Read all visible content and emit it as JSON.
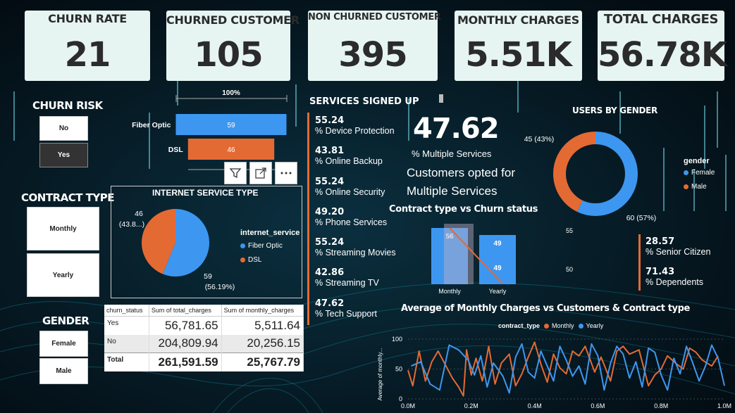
{
  "colors": {
    "orange": "#e46a33",
    "blue": "#3d97f0",
    "card": "#e6f5f2",
    "bg": "#041018"
  },
  "cards": [
    {
      "label": "CHURN RATE",
      "value": "21"
    },
    {
      "label": "CHURNED CUSTOMER",
      "value": "105"
    },
    {
      "label": "NON CHURNED CUSTOMER",
      "value": "395"
    },
    {
      "label": "MONTHLY CHARGES",
      "value": "5.51K"
    },
    {
      "label": "TOTAL CHARGES",
      "value": "56.78K"
    }
  ],
  "slicers": {
    "churn_risk": {
      "title": "CHURN RISK",
      "options": [
        "No",
        "Yes"
      ],
      "selected": "Yes"
    },
    "contract_type": {
      "title": "CONTRACT TYPE",
      "options": [
        "Monthly",
        "Yearly"
      ]
    },
    "gender": {
      "title": "GENDER",
      "options": [
        "Female",
        "Male"
      ]
    }
  },
  "visual_icons": [
    "filter-icon",
    "focus-mode-icon",
    "more-options-icon"
  ],
  "services": {
    "title": "SERVICES SIGNED UP",
    "items": [
      {
        "value": "55.24",
        "label": "% Device Protection"
      },
      {
        "value": "43.81",
        "label": "% Online Backup"
      },
      {
        "value": "55.24",
        "label": "% Online Security"
      },
      {
        "value": "49.20",
        "label": "% Phone Services"
      },
      {
        "value": "55.24",
        "label": "% Streaming Movies"
      },
      {
        "value": "42.86",
        "label": "% Streaming TV"
      },
      {
        "value": "47.62",
        "label": "% Tech Support"
      }
    ]
  },
  "multiple_services": {
    "value": "47.62",
    "label": "% Multiple Services",
    "note": "Customers opted for Multiple Services"
  },
  "demographics": [
    {
      "value": "28.57",
      "label": "% Senior Citizen"
    },
    {
      "value": "71.43",
      "label": "% Dependents"
    }
  ],
  "matrix": {
    "headers": [
      "churn_status",
      "Sum of total_charges",
      "Sum of monthly_charges"
    ],
    "rows": [
      {
        "label": "Yes",
        "total": "56,781.65",
        "monthly": "5,511.64"
      },
      {
        "label": "No",
        "total": "204,809.94",
        "monthly": "20,256.15"
      }
    ],
    "total": {
      "label": "Total",
      "total": "261,591.59",
      "monthly": "25,767.79"
    }
  },
  "chart_data": [
    {
      "type": "bar",
      "id": "funnel",
      "orientation": "horizontal-funnel",
      "categories": [
        "Fiber Optic",
        "DSL"
      ],
      "values": [
        59,
        46
      ],
      "top_label": "100%"
    },
    {
      "type": "pie",
      "id": "internet-service",
      "title": "INTERNET SERVICE TYPE",
      "legend_title": "internet_service",
      "legend_position": "right",
      "slices": [
        {
          "name": "Fiber Optic",
          "value": 59,
          "label": "59",
          "pct_label": "(56.19%)"
        },
        {
          "name": "DSL",
          "value": 46,
          "label": "46",
          "pct_label": "(43.8...)"
        }
      ]
    },
    {
      "type": "pie",
      "id": "users-by-gender",
      "title": "USERS BY GENDER",
      "variant": "donut",
      "legend_title": "gender",
      "legend_position": "right",
      "slices": [
        {
          "name": "Female",
          "value": 60,
          "label": "60 (57%)"
        },
        {
          "name": "Male",
          "value": 45,
          "label": "45 (43%)"
        }
      ]
    },
    {
      "type": "bar",
      "id": "contract-vs-churn",
      "title": "Contract type vs Churn status",
      "categories": [
        "Monthly",
        "Yearly"
      ],
      "values": [
        56,
        49
      ],
      "line_values": [
        56,
        49
      ],
      "secondary_axis_ticks": [
        "55",
        "50"
      ]
    },
    {
      "type": "line",
      "id": "monthly-charges",
      "title": "Average of Monthly Charges vs Customers & Contract type",
      "legend_title": "contract_type",
      "legend_position": "top",
      "ylabel": "Average of monthly...",
      "xlabel": "",
      "xlim": [
        0,
        1000000
      ],
      "ylim": [
        0,
        100
      ],
      "yticks": [
        0,
        50,
        100
      ],
      "xticks": [
        "0.0M",
        "0.2M",
        "0.4M",
        "0.6M",
        "0.8M",
        "1.0M"
      ],
      "series": [
        {
          "name": "Monthly",
          "color": "#e46a33",
          "values": [
            [
              0,
              48
            ],
            [
              15000,
              22
            ],
            [
              35000,
              80
            ],
            [
              55000,
              30
            ],
            [
              75000,
              62
            ],
            [
              95000,
              80
            ],
            [
              120000,
              55
            ],
            [
              140000,
              35
            ],
            [
              160000,
              20
            ],
            [
              175000,
              5
            ],
            [
              185000,
              82
            ],
            [
              200000,
              40
            ],
            [
              215000,
              68
            ],
            [
              235000,
              30
            ],
            [
              255000,
              88
            ],
            [
              275000,
              25
            ],
            [
              295000,
              60
            ],
            [
              320000,
              75
            ],
            [
              340000,
              22
            ],
            [
              360000,
              42
            ],
            [
              380000,
              70
            ],
            [
              400000,
              95
            ],
            [
              420000,
              58
            ],
            [
              440000,
              28
            ],
            [
              460000,
              75
            ],
            [
              480000,
              52
            ],
            [
              500000,
              42
            ],
            [
              520000,
              80
            ],
            [
              540000,
              72
            ],
            [
              560000,
              88
            ],
            [
              590000,
              45
            ],
            [
              610000,
              70
            ],
            [
              640000,
              30
            ],
            [
              660000,
              80
            ],
            [
              680000,
              88
            ],
            [
              700000,
              75
            ],
            [
              730000,
              82
            ],
            [
              760000,
              22
            ],
            [
              780000,
              40
            ],
            [
              800000,
              50
            ],
            [
              820000,
              72
            ],
            [
              850000,
              58
            ],
            [
              870000,
              50
            ],
            [
              890000,
              85
            ],
            [
              910000,
              78
            ],
            [
              930000,
              65
            ],
            [
              960000,
              55
            ],
            [
              980000,
              72
            ]
          ]
        },
        {
          "name": "Yearly",
          "color": "#3d97f0",
          "values": [
            [
              10000,
              55
            ],
            [
              40000,
              62
            ],
            [
              70000,
              25
            ],
            [
              100000,
              15
            ],
            [
              130000,
              90
            ],
            [
              160000,
              82
            ],
            [
              190000,
              65
            ],
            [
              210000,
              40
            ],
            [
              230000,
              72
            ],
            [
              250000,
              20
            ],
            [
              270000,
              60
            ],
            [
              300000,
              38
            ],
            [
              320000,
              10
            ],
            [
              340000,
              70
            ],
            [
              360000,
              92
            ],
            [
              380000,
              45
            ],
            [
              400000,
              35
            ],
            [
              420000,
              80
            ],
            [
              440000,
              55
            ],
            [
              460000,
              30
            ],
            [
              480000,
              88
            ],
            [
              500000,
              65
            ],
            [
              520000,
              38
            ],
            [
              540000,
              55
            ],
            [
              560000,
              25
            ],
            [
              580000,
              92
            ],
            [
              600000,
              72
            ],
            [
              620000,
              15
            ],
            [
              640000,
              60
            ],
            [
              660000,
              88
            ],
            [
              680000,
              75
            ],
            [
              700000,
              35
            ],
            [
              720000,
              62
            ],
            [
              740000,
              20
            ],
            [
              760000,
              85
            ],
            [
              780000,
              78
            ],
            [
              800000,
              40
            ],
            [
              820000,
              15
            ],
            [
              840000,
              68
            ],
            [
              860000,
              42
            ],
            [
              880000,
              88
            ],
            [
              900000,
              60
            ],
            [
              920000,
              30
            ],
            [
              940000,
              55
            ],
            [
              960000,
              90
            ],
            [
              980000,
              68
            ],
            [
              1000000,
              22
            ]
          ]
        }
      ]
    }
  ]
}
